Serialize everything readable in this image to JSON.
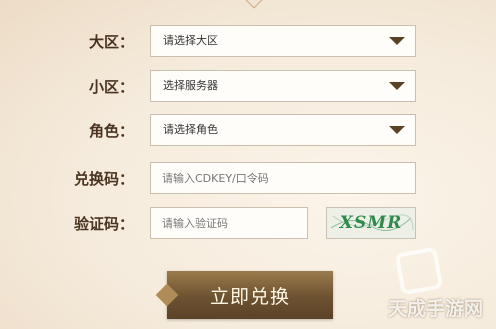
{
  "form": {
    "region": {
      "label": "大区：",
      "value": "请选择大区"
    },
    "subregion": {
      "label": "小区：",
      "value": "选择服务器"
    },
    "role": {
      "label": "角色：",
      "value": "请选择角色"
    },
    "code": {
      "label": "兑换码：",
      "placeholder": "请输入CDKEY/口令码"
    },
    "captcha": {
      "label": "验证码：",
      "placeholder": "请输入验证码",
      "image_text": "XSMR"
    },
    "submit_label": "立即兑换"
  },
  "watermark": {
    "text": "天成手游网"
  },
  "colors": {
    "label": "#4a3420",
    "button": "#6d5231",
    "caret": "#5a4224",
    "captcha_text": "#2f8a4c"
  }
}
